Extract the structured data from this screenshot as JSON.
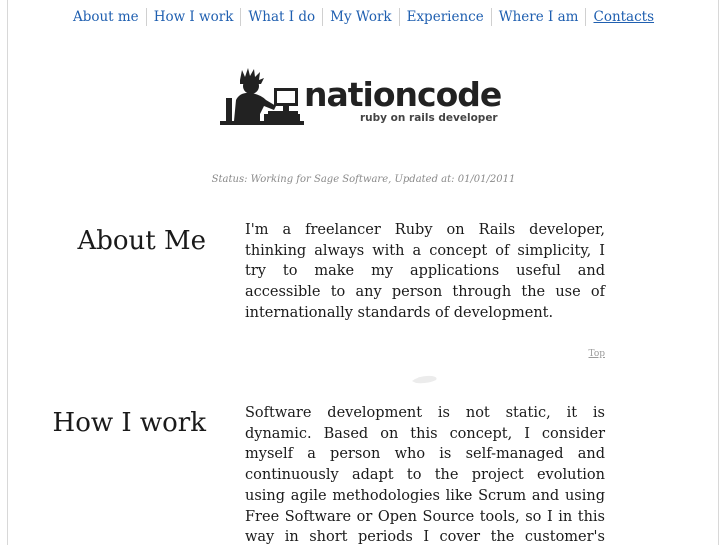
{
  "nav": {
    "items": [
      {
        "label": "About me"
      },
      {
        "label": "How I work"
      },
      {
        "label": "What I do"
      },
      {
        "label": "My Work"
      },
      {
        "label": "Experience"
      },
      {
        "label": "Where I am"
      },
      {
        "label": "Contacts",
        "active": true
      }
    ]
  },
  "logo": {
    "wordmark": "nationcode",
    "tagline": "ruby on rails developer"
  },
  "status": {
    "text": "Status: Working for Sage Software, Updated at: 01/01/2011"
  },
  "sections": [
    {
      "title": "About Me",
      "body": "I'm a freelancer Ruby on Rails developer, thinking always with a concept of simplicity, I try to make my applications useful and accessible to any person through the use of internationally standards of development.",
      "top_label": "Top"
    },
    {
      "title": "How I work",
      "body": "Software development is not static, it is dynamic. Based on this concept, I consider myself a person who is self-managed and continuously adapt to the project evolution using agile methodologies like Scrum and using Free Software or Open Source tools, so I in this way in short periods I cover the customer's expectations while the customer test their"
    }
  ],
  "colors": {
    "link": "#1f5fb0",
    "text": "#1a1a1a",
    "muted": "#8a8a8a"
  }
}
